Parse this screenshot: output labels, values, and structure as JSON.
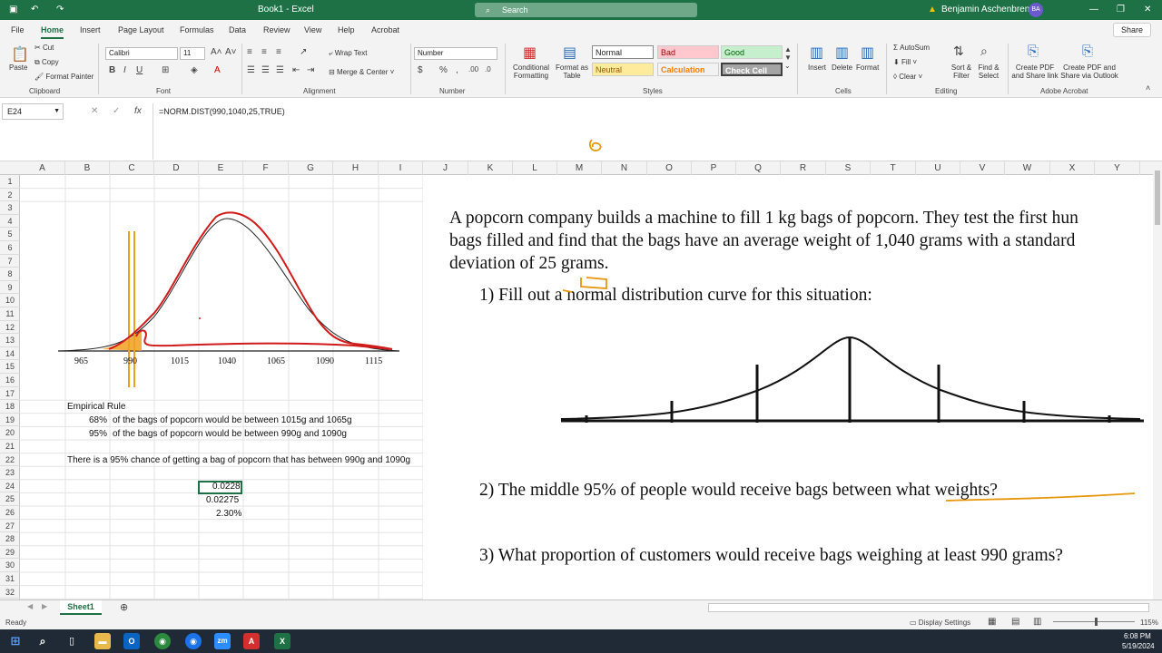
{
  "window": {
    "title": "Book1 - Excel",
    "search_placeholder": "Search",
    "user_name": "Benjamin Aschenbrenner",
    "user_initials": "BA"
  },
  "tabs": [
    "File",
    "Home",
    "Insert",
    "Page Layout",
    "Formulas",
    "Data",
    "Review",
    "View",
    "Help",
    "Acrobat"
  ],
  "share_label": "Share",
  "ribbon": {
    "clipboard": {
      "paste": "Paste",
      "cut": "Cut",
      "copy": "Copy",
      "format_painter": "Format Painter",
      "group": "Clipboard"
    },
    "font": {
      "name": "Calibri",
      "size": "11",
      "group": "Font"
    },
    "alignment": {
      "wrap": "Wrap Text",
      "merge": "Merge & Center",
      "group": "Alignment"
    },
    "number": {
      "format": "Number",
      "group": "Number"
    },
    "styles": {
      "conditional": "Conditional Formatting",
      "format_table": "Format as Table",
      "normal": "Normal",
      "bad": "Bad",
      "good": "Good",
      "neutral": "Neutral",
      "calculation": "Calculation",
      "check_cell": "Check Cell",
      "group": "Styles"
    },
    "cells": {
      "insert": "Insert",
      "delete": "Delete",
      "format": "Format",
      "group": "Cells"
    },
    "editing": {
      "autosum": "AutoSum",
      "fill": "Fill",
      "clear": "Clear",
      "sort": "Sort & Filter",
      "find": "Find & Select",
      "group": "Editing"
    },
    "acrobat": {
      "create_pdf": "Create PDF and Share link",
      "create_outlook": "Create PDF and Share via Outlook",
      "group": "Adobe Acrobat"
    }
  },
  "formula_bar": {
    "name_box": "E24",
    "formula": "=NORM.DIST(990,1040,25,TRUE)"
  },
  "columns": [
    "A",
    "B",
    "C",
    "D",
    "E",
    "F",
    "G",
    "H",
    "I",
    "J",
    "K",
    "L",
    "M",
    "N",
    "O",
    "P",
    "Q",
    "R",
    "S",
    "T",
    "U",
    "V",
    "W",
    "X",
    "Y"
  ],
  "rows": [
    "1",
    "2",
    "3",
    "4",
    "5",
    "6",
    "7",
    "8",
    "9",
    "10",
    "11",
    "12",
    "13",
    "14",
    "15",
    "16",
    "17",
    "18",
    "19",
    "20",
    "21",
    "22",
    "23",
    "24",
    "25",
    "26",
    "27",
    "28",
    "29",
    "30",
    "31",
    "32"
  ],
  "cells": {
    "r18": "Empirical Rule",
    "r19_pct": "68%",
    "r19": "of the bags of popcorn would be between 1015g and 1065g",
    "r20_pct": "95%",
    "r20": "of the bags of popcorn would be between 990g and 1090g",
    "r22": "There is a 95% chance of getting a bag of popcorn that has between 990g and 1090g",
    "e24": "0.0228",
    "e25": "0.02275",
    "e26": "2.30%"
  },
  "curve_ticks": [
    "965",
    "990",
    "1015",
    "1040",
    "1065",
    "1090",
    "1115"
  ],
  "problem": {
    "line1": "A popcorn company builds a machine to fill 1 kg bags of popcorn. They test the first hun",
    "line2": "bags filled and find that the bags have an average weight of 1,040 grams with a standard",
    "line3": "deviation of 25 grams.",
    "q1": "1) Fill out a normal distribution curve for this situation:",
    "q2": "2) The middle 95% of people would receive bags between what weights?",
    "q3": "3) What proportion of customers would receive bags weighing at least 990 grams?"
  },
  "sheet_tab": "Sheet1",
  "status": {
    "ready": "Ready",
    "display_settings": "Display Settings",
    "zoom": "115%"
  },
  "taskbar": {
    "time": "6:08 PM",
    "date": "5/19/2024"
  },
  "colors": {
    "excel_green": "#1e7145",
    "pen_red": "#d11a1a",
    "highlight_orange": "#f0a020"
  }
}
